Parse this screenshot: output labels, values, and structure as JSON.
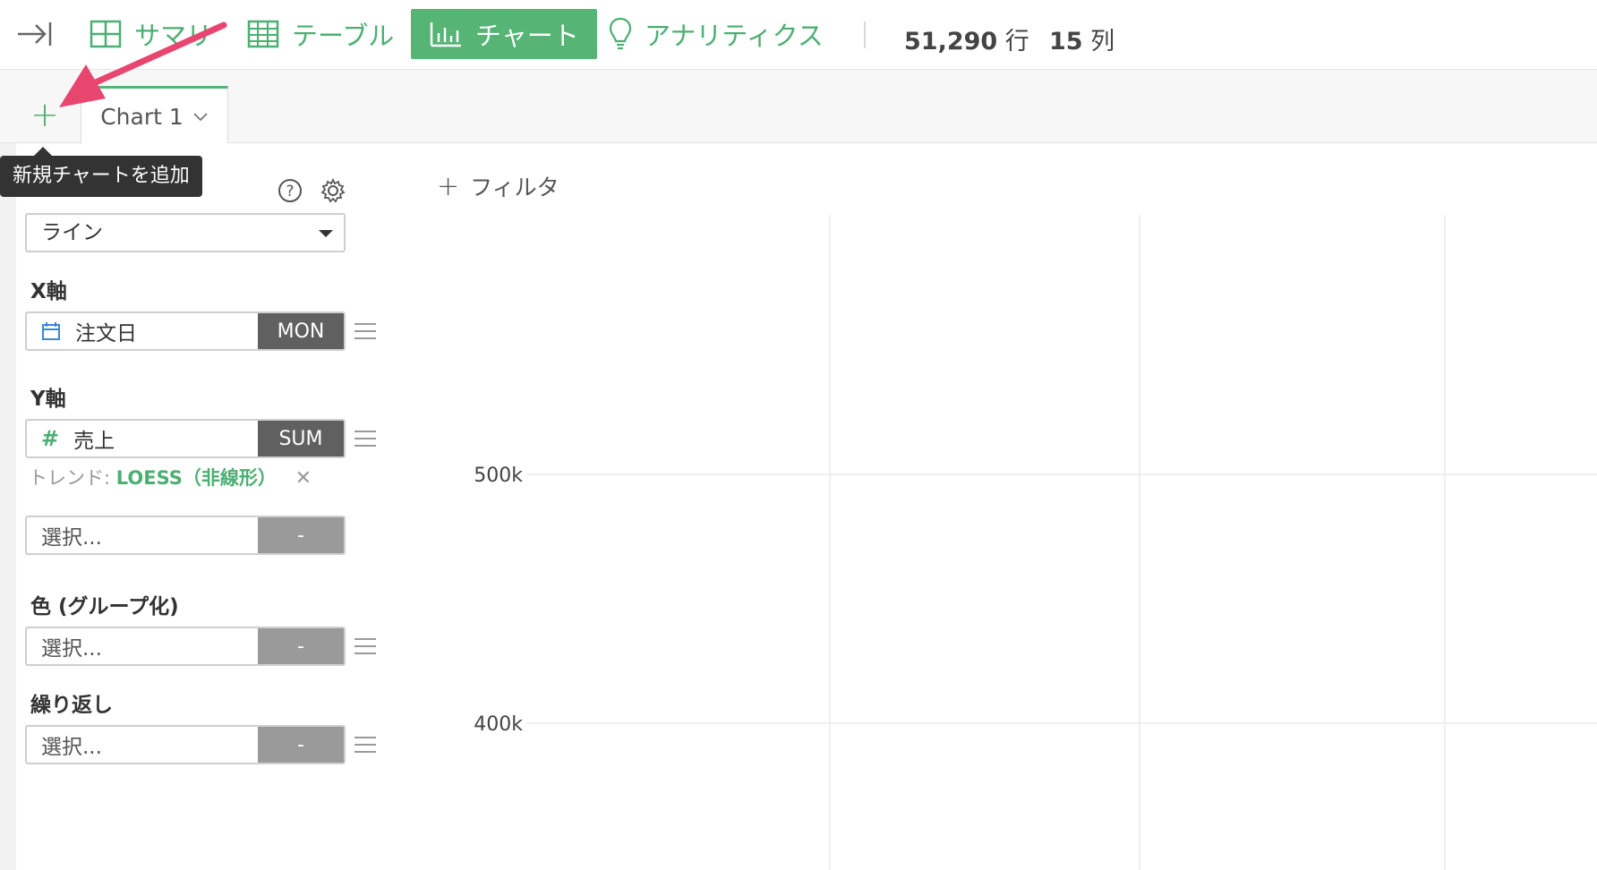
{
  "toolbar": {
    "tabs": [
      {
        "label": "サマリ",
        "icon": "summary-grid-icon"
      },
      {
        "label": "テーブル",
        "icon": "table-icon"
      },
      {
        "label": "チャート",
        "icon": "bar-chart-icon",
        "active": true
      },
      {
        "label": "アナリティクス",
        "icon": "lightbulb-icon"
      }
    ],
    "rows_value": "51,290",
    "rows_unit": "行",
    "cols_value": "15",
    "cols_unit": "列"
  },
  "chart_tabs": {
    "tab_label": "Chart 1",
    "tooltip": "新規チャートを追加"
  },
  "panel": {
    "chart_type": "ライン",
    "x_axis": {
      "label": "X軸",
      "field": "注文日",
      "agg": "MON"
    },
    "y_axis": {
      "label": "Y軸",
      "field": "売上",
      "agg": "SUM"
    },
    "trend_label": "トレンド:",
    "trend_value": "LOESS（非線形）",
    "extra_select": {
      "placeholder": "選択...",
      "agg": "-"
    },
    "color": {
      "label": "色 (グループ化)",
      "placeholder": "選択...",
      "agg": "-"
    },
    "repeat": {
      "label": "繰り返し",
      "placeholder": "選択...",
      "agg": "-"
    }
  },
  "filter_label": "フィルタ",
  "colors": {
    "accent": "#56b474",
    "arrow": "#e8456f"
  },
  "chart_data": {
    "type": "line",
    "y_ticks": [
      "500k",
      "400k"
    ],
    "ylabel": "",
    "xlabel": "",
    "grid": true,
    "series": []
  }
}
